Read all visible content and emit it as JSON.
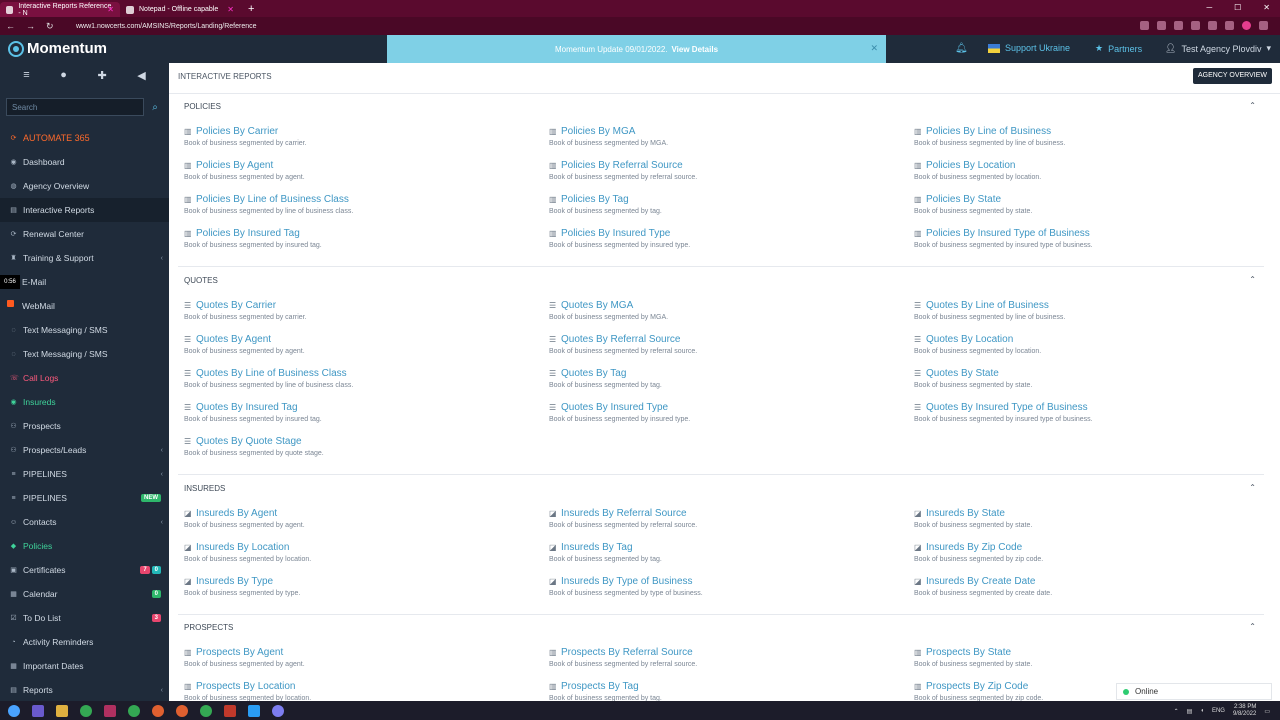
{
  "browser": {
    "tabs": [
      {
        "title": "Interactive Reports Reference - N",
        "active": true
      },
      {
        "title": "Notepad - Offline capable",
        "active": false
      }
    ],
    "url": "www1.nowcerts.com/AMSINS/Reports/Landing/Reference"
  },
  "topbar": {
    "app_name": "Momentum",
    "banner_text": "Momentum Update 09/01/2022.",
    "banner_link": "View Details",
    "support_label": "Support Ukraine",
    "partners_label": "Partners",
    "user_label": "Test Agency Plovdiv"
  },
  "sidebar": {
    "search_placeholder": "Search",
    "items": [
      {
        "label": "AUTOMATE 365",
        "icon": "automate-icon",
        "style": "orange"
      },
      {
        "label": "Dashboard",
        "icon": "dashboard-icon"
      },
      {
        "label": "Agency Overview",
        "icon": "globe-icon"
      },
      {
        "label": "Interactive Reports",
        "icon": "reports-icon",
        "style": "active"
      },
      {
        "label": "Renewal Center",
        "icon": "refresh-icon"
      },
      {
        "label": "Training & Support",
        "icon": "training-icon",
        "chevron": true
      },
      {
        "label": "E-Mail",
        "icon": "email-icon",
        "timer": "0:56"
      },
      {
        "label": "WebMail",
        "icon": "webmail-icon",
        "square": true
      },
      {
        "label": "Text Messaging / SMS",
        "icon": "sms-icon"
      },
      {
        "label": "Text Messaging / SMS",
        "icon": "sms-icon"
      },
      {
        "label": "Call Logs",
        "icon": "phone-icon",
        "style": "red"
      },
      {
        "label": "Insureds",
        "icon": "eye-icon",
        "style": "green"
      },
      {
        "label": "Prospects",
        "icon": "prospects-icon"
      },
      {
        "label": "Prospects/Leads",
        "icon": "leads-icon",
        "chevron": true
      },
      {
        "label": "PIPELINES",
        "icon": "pipeline-icon",
        "chevron": true
      },
      {
        "label": "PIPELINES",
        "icon": "pipeline-icon",
        "new_badge": "NEW"
      },
      {
        "label": "Contacts",
        "icon": "contacts-icon",
        "chevron": true
      },
      {
        "label": "Policies",
        "icon": "policies-icon",
        "style": "green"
      },
      {
        "label": "Certificates",
        "icon": "certificate-icon",
        "badges": [
          {
            "text": "7",
            "color": "red"
          },
          {
            "text": "0",
            "color": "teal"
          }
        ]
      },
      {
        "label": "Calendar",
        "icon": "calendar-icon",
        "badges": [
          {
            "text": "0",
            "color": "green"
          }
        ]
      },
      {
        "label": "To Do List",
        "icon": "todo-icon",
        "badges": [
          {
            "text": "3",
            "color": "red"
          }
        ]
      },
      {
        "label": "Activity Reminders",
        "icon": "reminder-icon"
      },
      {
        "label": "Important Dates",
        "icon": "dates-icon"
      },
      {
        "label": "Reports",
        "icon": "reports-icon",
        "chevron": true
      }
    ]
  },
  "main": {
    "page_title": "INTERACTIVE REPORTS",
    "agency_overview_btn": "AGENCY OVERVIEW",
    "sections": [
      {
        "title": "POLICIES",
        "icon": "bar-chart-icon",
        "cards": [
          {
            "title": "Policies By Carrier",
            "desc": "Book of business segmented by carrier."
          },
          {
            "title": "Policies By MGA",
            "desc": "Book of business segmented by MGA."
          },
          {
            "title": "Policies By Line of Business",
            "desc": "Book of business segmented by line of business."
          },
          {
            "title": "Policies By Agent",
            "desc": "Book of business segmented by agent."
          },
          {
            "title": "Policies By Referral Source",
            "desc": "Book of business segmented by referral source."
          },
          {
            "title": "Policies By Location",
            "desc": "Book of business segmented by location."
          },
          {
            "title": "Policies By Line of Business Class",
            "desc": "Book of business segmented by line of business class."
          },
          {
            "title": "Policies By Tag",
            "desc": "Book of business segmented by tag."
          },
          {
            "title": "Policies By State",
            "desc": "Book of business segmented by state."
          },
          {
            "title": "Policies By Insured Tag",
            "desc": "Book of business segmented by insured tag."
          },
          {
            "title": "Policies By Insured Type",
            "desc": "Book of business segmented by insured type."
          },
          {
            "title": "Policies By Insured Type of Business",
            "desc": "Book of business segmented by insured type of business."
          }
        ]
      },
      {
        "title": "QUOTES",
        "icon": "list-icon",
        "cards": [
          {
            "title": "Quotes By Carrier",
            "desc": "Book of business segmented by carrier."
          },
          {
            "title": "Quotes By MGA",
            "desc": "Book of business segmented by MGA."
          },
          {
            "title": "Quotes By Line of Business",
            "desc": "Book of business segmented by line of business."
          },
          {
            "title": "Quotes By Agent",
            "desc": "Book of business segmented by agent."
          },
          {
            "title": "Quotes By Referral Source",
            "desc": "Book of business segmented by referral source."
          },
          {
            "title": "Quotes By Location",
            "desc": "Book of business segmented by location."
          },
          {
            "title": "Quotes By Line of Business Class",
            "desc": "Book of business segmented by line of business class."
          },
          {
            "title": "Quotes By Tag",
            "desc": "Book of business segmented by tag."
          },
          {
            "title": "Quotes By State",
            "desc": "Book of business segmented by state."
          },
          {
            "title": "Quotes By Insured Tag",
            "desc": "Book of business segmented by insured tag."
          },
          {
            "title": "Quotes By Insured Type",
            "desc": "Book of business segmented by insured type."
          },
          {
            "title": "Quotes By Insured Type of Business",
            "desc": "Book of business segmented by insured type of business."
          },
          {
            "title": "Quotes By Quote Stage",
            "desc": "Book of business segmented by quote stage."
          }
        ]
      },
      {
        "title": "INSUREDS",
        "icon": "area-chart-icon",
        "cards": [
          {
            "title": "Insureds By Agent",
            "desc": "Book of business segmented by agent."
          },
          {
            "title": "Insureds By Referral Source",
            "desc": "Book of business segmented by referral source."
          },
          {
            "title": "Insureds By State",
            "desc": "Book of business segmented by state."
          },
          {
            "title": "Insureds By Location",
            "desc": "Book of business segmented by location."
          },
          {
            "title": "Insureds By Tag",
            "desc": "Book of business segmented by tag."
          },
          {
            "title": "Insureds By Zip Code",
            "desc": "Book of business segmented by zip code."
          },
          {
            "title": "Insureds By Type",
            "desc": "Book of business segmented by type."
          },
          {
            "title": "Insureds By Type of Business",
            "desc": "Book of business segmented by type of business."
          },
          {
            "title": "Insureds By Create Date",
            "desc": "Book of business segmented by create date."
          }
        ]
      },
      {
        "title": "PROSPECTS",
        "icon": "bar-chart-icon",
        "cards": [
          {
            "title": "Prospects By Agent",
            "desc": "Book of business segmented by agent."
          },
          {
            "title": "Prospects By Referral Source",
            "desc": "Book of business segmented by referral source."
          },
          {
            "title": "Prospects By State",
            "desc": "Book of business segmented by state."
          },
          {
            "title": "Prospects By Location",
            "desc": "Book of business segmented by location."
          },
          {
            "title": "Prospects By Tag",
            "desc": "Book of business segmented by tag."
          },
          {
            "title": "Prospects By Zip Code",
            "desc": "Book of business segmented by zip code."
          }
        ]
      }
    ]
  },
  "status": {
    "online_label": "Online"
  },
  "taskbar": {
    "lang": "ENG",
    "time": "2:38 PM",
    "date": "9/8/2022"
  }
}
